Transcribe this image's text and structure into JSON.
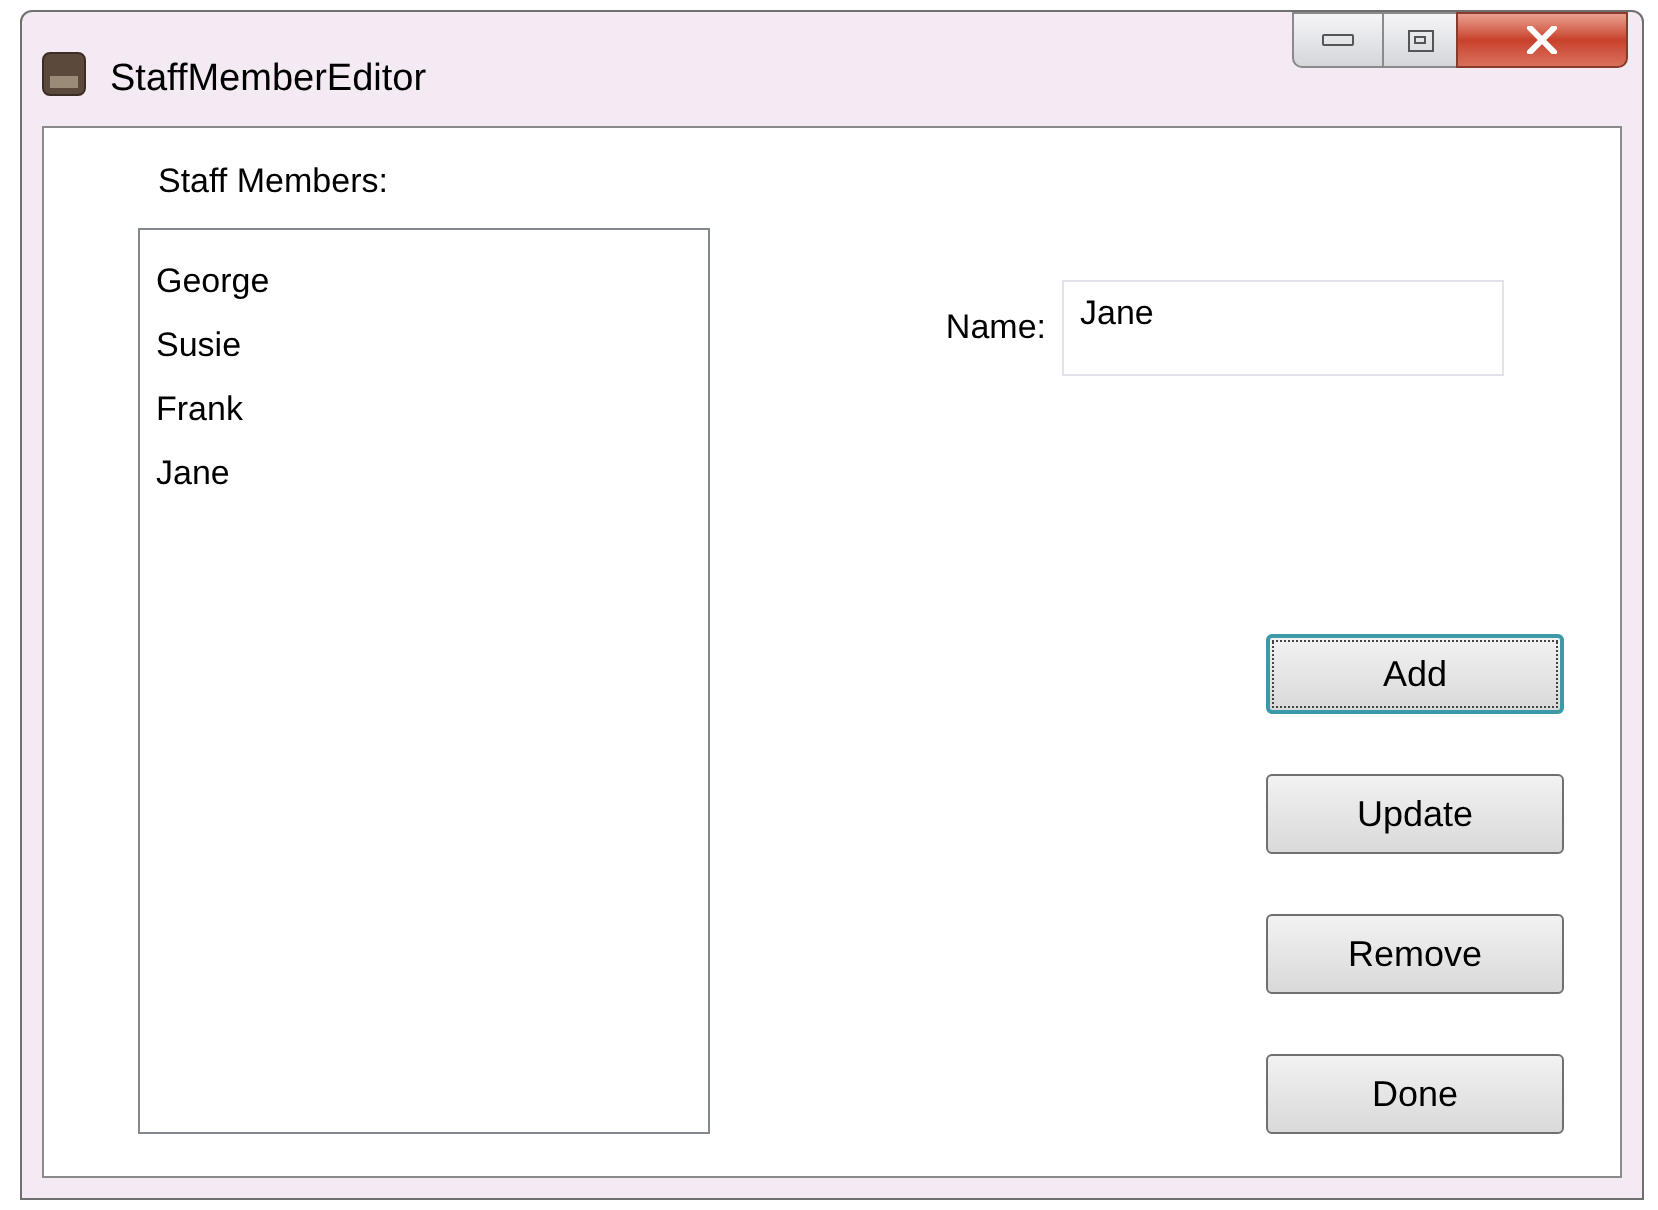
{
  "window": {
    "title": "StaffMemberEditor"
  },
  "staff_list": {
    "label": "Staff Members:",
    "items": [
      "George",
      "Susie",
      "Frank",
      "Jane"
    ]
  },
  "name_field": {
    "label": "Name:",
    "value": "Jane"
  },
  "buttons": [
    {
      "label": "Add",
      "focused": true
    },
    {
      "label": "Update",
      "focused": false
    },
    {
      "label": "Remove",
      "focused": false
    },
    {
      "label": "Done",
      "focused": false
    }
  ]
}
